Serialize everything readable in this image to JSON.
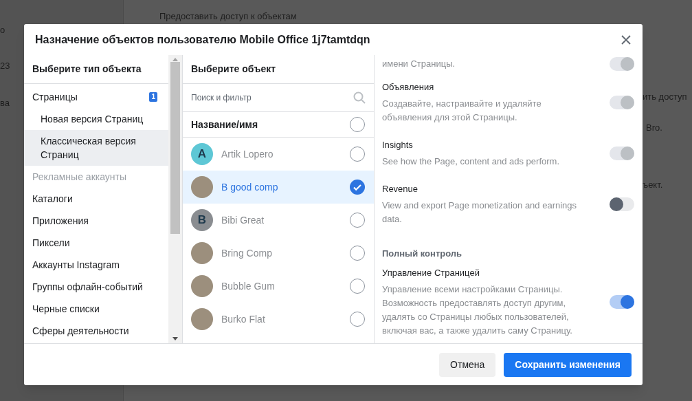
{
  "background": {
    "texts": [
      "о",
      "23",
      "ва",
      "Предоставить доступ к объектам",
      "ить доступ",
      "Bro.",
      "ъект."
    ]
  },
  "dialog": {
    "title": "Назначение объектов пользователю Mobile Office 1j7tamtdqn"
  },
  "object_types": {
    "heading": "Выберите тип объекта",
    "items": [
      {
        "label": "Страницы",
        "badge": "1",
        "selected": false,
        "disabled": false,
        "children": [
          {
            "label": "Новая версия Страниц",
            "selected": false,
            "disabled": false
          },
          {
            "label": "Классическая версия Страниц",
            "selected": true,
            "disabled": false
          }
        ]
      },
      {
        "label": "Рекламные аккаунты",
        "selected": false,
        "disabled": true
      },
      {
        "label": "Каталоги",
        "selected": false,
        "disabled": false
      },
      {
        "label": "Приложения",
        "selected": false,
        "disabled": false
      },
      {
        "label": "Пиксели",
        "selected": false,
        "disabled": false
      },
      {
        "label": "Аккаунты Instagram",
        "selected": false,
        "disabled": false
      },
      {
        "label": "Группы офлайн-событий",
        "selected": false,
        "disabled": false
      },
      {
        "label": "Черные списки",
        "selected": false,
        "disabled": false
      },
      {
        "label": "Сферы деятельности",
        "selected": false,
        "disabled": false
      }
    ]
  },
  "objects": {
    "heading": "Выберите объект",
    "search": {
      "placeholder": "Поиск и фильтр"
    },
    "column": {
      "label": "Название/имя",
      "checked": false
    },
    "rows": [
      {
        "name": "Artik Lopero",
        "avatar": {
          "kind": "letter",
          "letter": "A",
          "color": "#5ec7d5"
        },
        "selected": false
      },
      {
        "name": "B good comp",
        "avatar": {
          "kind": "photo"
        },
        "selected": true
      },
      {
        "name": "Bibi Great",
        "avatar": {
          "kind": "letter",
          "letter": "B",
          "color": "#8a8d91"
        },
        "selected": false
      },
      {
        "name": "Bring Comp",
        "avatar": {
          "kind": "photo"
        },
        "selected": false
      },
      {
        "name": "Bubble Gum",
        "avatar": {
          "kind": "photo"
        },
        "selected": false
      },
      {
        "name": "Burko Flat",
        "avatar": {
          "kind": "photo"
        },
        "selected": false
      }
    ]
  },
  "permissions": [
    {
      "kind": "permission",
      "description": "имени Страницы.",
      "on": true,
      "disabled": true
    },
    {
      "kind": "permission",
      "title": "Объявления",
      "description": "Создавайте, настраивайте и удаляйте объявления для этой Страницы.",
      "on": true,
      "disabled": true
    },
    {
      "kind": "permission",
      "title": "Insights",
      "description": "See how the Page, content and ads perform.",
      "on": true,
      "disabled": true
    },
    {
      "kind": "permission",
      "title": "Revenue",
      "description": "View and export Page monetization and earnings data.",
      "on": false,
      "disabled": false
    },
    {
      "kind": "section",
      "title": "Полный контроль"
    },
    {
      "kind": "permission",
      "title": "Управление Страницей",
      "description": "Управление всеми настройками Страницы. Возможность предоставлять доступ другим, удалять со Страницы любых пользователей, включая вас, а также удалить саму Страницу.",
      "on": true,
      "disabled": false
    }
  ],
  "buttons": [
    {
      "label": "Отмена",
      "kind": "secondary"
    },
    {
      "label": "Сохранить изменения",
      "kind": "primary"
    }
  ]
}
